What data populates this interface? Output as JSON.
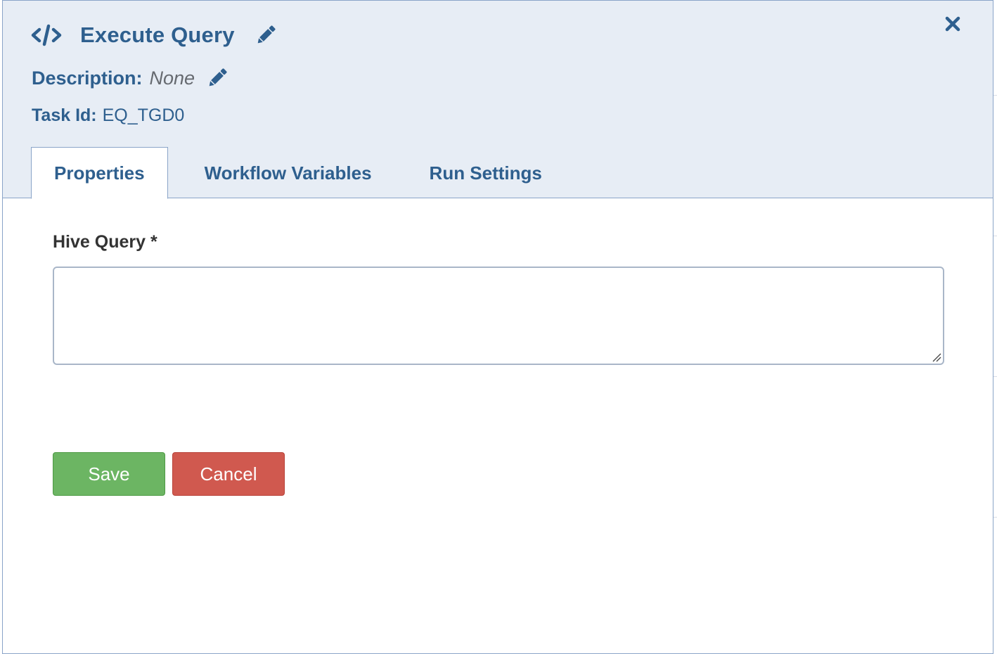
{
  "header": {
    "title": "Execute Query",
    "description_label": "Description:",
    "description_value": "None",
    "task_id_label": "Task Id:",
    "task_id_value": "EQ_TGD0"
  },
  "tabs": [
    {
      "label": "Properties",
      "active": true
    },
    {
      "label": "Workflow Variables",
      "active": false
    },
    {
      "label": "Run Settings",
      "active": false
    }
  ],
  "form": {
    "hive_query_label": "Hive Query *",
    "hive_query_value": ""
  },
  "buttons": {
    "save": "Save",
    "cancel": "Cancel"
  },
  "icons": {
    "title_icon": "code-icon",
    "title_edit": "pencil-icon",
    "description_edit": "pencil-icon",
    "close": "close-icon"
  },
  "colors": {
    "accent": "#2e5f8e",
    "header_bg": "#e7edf5",
    "save": "#6cb563",
    "cancel": "#d0594f"
  }
}
